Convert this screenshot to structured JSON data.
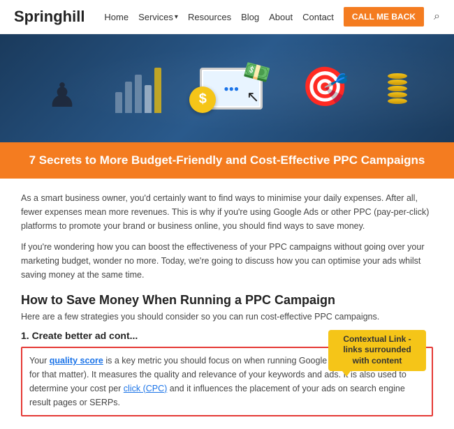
{
  "header": {
    "logo": "Springhill",
    "nav_items": [
      "Home",
      "Services",
      "Resources",
      "Blog",
      "About",
      "Contact"
    ],
    "cta_label": "CALL ME BACK",
    "search_icon": "🔍"
  },
  "hero": {
    "alt": "PPC Campaign illustration"
  },
  "title": "7 Secrets to More Budget-Friendly and Cost-Effective PPC Campaigns",
  "intro": [
    "As a smart business owner, you'd certainly want to find ways to minimise your daily expenses. After all, fewer expenses mean more revenues. This is why if you're using Google Ads or other PPC (pay-per-click) platforms to promote your brand or business online, you should find ways to save money.",
    "If you're wondering how you can boost the effectiveness of your PPC campaigns without going over your marketing budget, wonder no more. Today, we're going to discuss how you can optimise your ads whilst saving money at the same time."
  ],
  "section_heading": "How to Save Money When Running a PPC Campaign",
  "section_subtext": "Here are a few strategies you should consider so you can run cost-effective PPC campaigns.",
  "sub_heading": "1. Create better ad cont...",
  "tooltip": {
    "label": "Contextual Link - links surrounded with content"
  },
  "highlight_paragraph": "Your quality score is a key metric you should focus on when running Google Ads (or other PPC ads for that matter). It measures the quality and relevance of your keywords and ads. It is also used to determine your cost per click (CPC) and it influences the placement of your ads on search engine result pages or SERPs."
}
